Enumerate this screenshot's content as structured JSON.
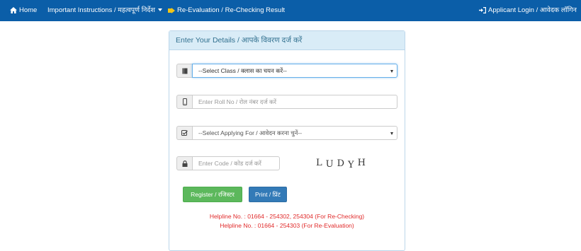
{
  "navbar": {
    "home": "Home",
    "instructions": "Important Instructions / महत्वपूर्ण निर्देश",
    "reevaluation": "Re-Evaluation / Re-Checking Result",
    "login": "Applicant Login / आवेदक लॉगिन"
  },
  "panel": {
    "heading": "Enter Your Details / आपके विवरण दर्ज करें",
    "class_select": "--Select Class / क्लास का चयन करें--",
    "roll_placeholder": "Enter Roll No / रोल नंबर दर्ज करें",
    "applying_select": "--Select Applying For / आवेदन करना चुनें--",
    "code_placeholder": "Enter Code / कोड दर्ज करें",
    "captcha": [
      "L",
      "U",
      "D",
      "Y",
      "H"
    ],
    "register_label": "Register / रजिस्टर",
    "print_label": "Print / प्रिंट",
    "helpline_1": "Helpline No. : 01664 - 254302, 254304 (For Re-Checking)",
    "helpline_2": "Helpline No. : 01664 - 254303 (For Re-Evaluation)"
  },
  "colors": {
    "navbar": "#0b5ea8",
    "panel_heading": "#d9ecf7",
    "register_button": "#5cb85c",
    "print_button": "#337ab7",
    "helpline_text": "#e02a2a"
  }
}
